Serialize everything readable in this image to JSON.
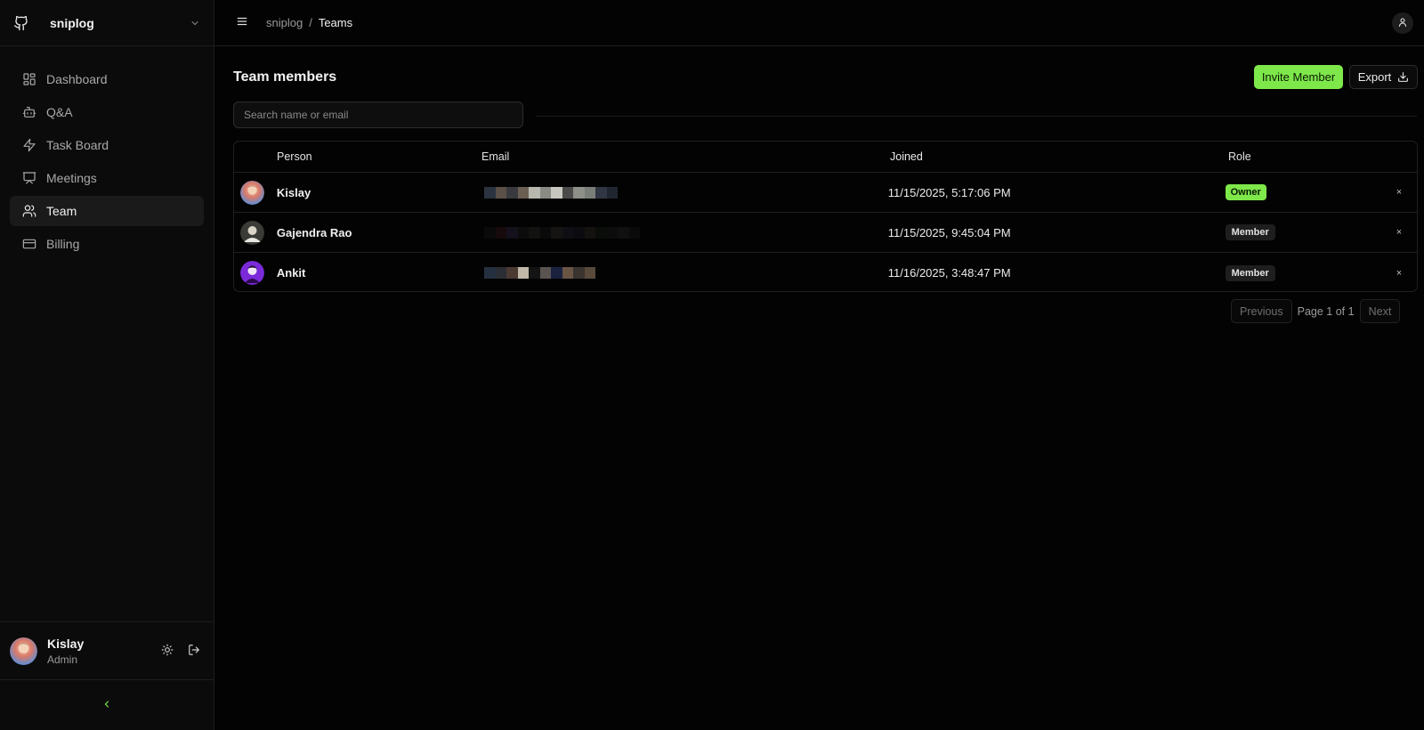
{
  "app": {
    "name": "sniplog"
  },
  "sidebar": {
    "items": [
      {
        "label": "Dashboard",
        "icon": "grid-icon",
        "active": false
      },
      {
        "label": "Q&A",
        "icon": "bot-icon",
        "active": false
      },
      {
        "label": "Task Board",
        "icon": "lightning-icon",
        "active": false
      },
      {
        "label": "Meetings",
        "icon": "presentation-icon",
        "active": false
      },
      {
        "label": "Team",
        "icon": "users-icon",
        "active": true
      },
      {
        "label": "Billing",
        "icon": "credit-card-icon",
        "active": false
      }
    ],
    "user": {
      "name": "Kislay",
      "role": "Admin"
    }
  },
  "topbar": {
    "breadcrumb": {
      "parent": "sniplog",
      "separator": "/",
      "current": "Teams"
    }
  },
  "main": {
    "title": "Team members",
    "invite_label": "Invite Member",
    "export_label": "Export",
    "search": {
      "placeholder": "Search name or email",
      "value": ""
    },
    "table": {
      "columns": {
        "person": "Person",
        "email": "Email",
        "joined": "Joined",
        "role": "Role"
      },
      "rows": [
        {
          "person": "Kislay",
          "joined": "11/15/2025, 5:17:06 PM",
          "role": "Owner",
          "remove": "×"
        },
        {
          "person": "Gajendra Rao",
          "joined": "11/15/2025, 9:45:04 PM",
          "role": "Member",
          "remove": "×"
        },
        {
          "person": "Ankit",
          "joined": "11/16/2025, 3:48:47 PM",
          "role": "Member",
          "remove": "×"
        }
      ]
    },
    "pagination": {
      "previous": "Previous",
      "info": "Page 1 of 1",
      "next": "Next"
    }
  },
  "colors": {
    "accent": "#7ee84a",
    "background": "#030303",
    "sidebar": "#0b0b0b"
  }
}
